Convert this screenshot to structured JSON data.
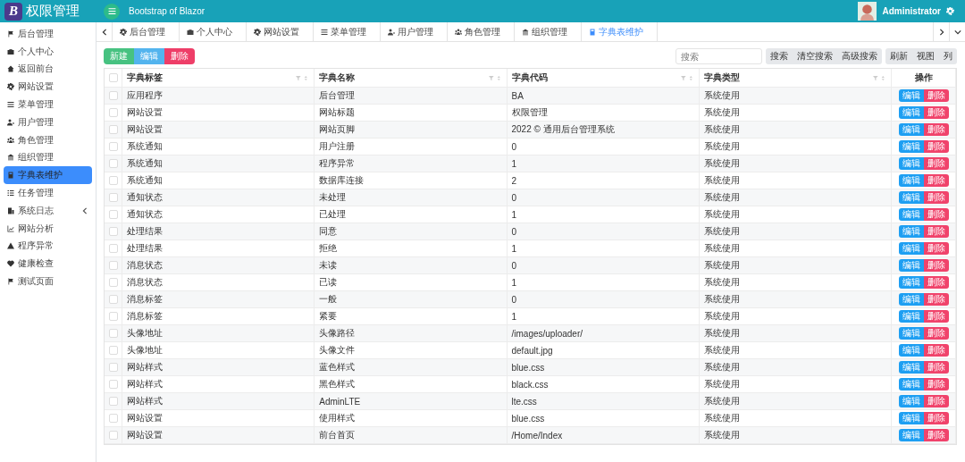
{
  "header": {
    "logo": "B",
    "title": "权限管理",
    "subtitle": "Bootstrap of Blazor",
    "user": "Administrator"
  },
  "sidebar": {
    "items": [
      {
        "label": "后台管理",
        "selected": false,
        "kind": "link"
      },
      {
        "label": "个人中心",
        "selected": false,
        "kind": "link"
      },
      {
        "label": "返回前台",
        "selected": false,
        "kind": "link"
      },
      {
        "label": "网站设置",
        "selected": false,
        "kind": "link"
      },
      {
        "label": "菜单管理",
        "selected": false,
        "kind": "link"
      },
      {
        "label": "用户管理",
        "selected": false,
        "kind": "link"
      },
      {
        "label": "角色管理",
        "selected": false,
        "kind": "link"
      },
      {
        "label": "组织管理",
        "selected": false,
        "kind": "link"
      },
      {
        "label": "字典表维护",
        "selected": true,
        "kind": "link"
      },
      {
        "label": "任务管理",
        "selected": false,
        "kind": "link"
      },
      {
        "label": "系统日志",
        "selected": false,
        "kind": "group"
      },
      {
        "label": "网站分析",
        "selected": false,
        "kind": "link"
      },
      {
        "label": "程序异常",
        "selected": false,
        "kind": "link"
      },
      {
        "label": "健康检查",
        "selected": false,
        "kind": "link"
      },
      {
        "label": "测试页面",
        "selected": false,
        "kind": "link"
      }
    ]
  },
  "tabs": [
    {
      "label": "后台管理",
      "selected": false
    },
    {
      "label": "个人中心",
      "selected": false
    },
    {
      "label": "网站设置",
      "selected": false
    },
    {
      "label": "菜单管理",
      "selected": false
    },
    {
      "label": "用户管理",
      "selected": false
    },
    {
      "label": "角色管理",
      "selected": false
    },
    {
      "label": "组织管理",
      "selected": false
    },
    {
      "label": "字典表维护",
      "selected": true
    }
  ],
  "toolbar": {
    "actions": [
      {
        "label": "新建",
        "kind": "create"
      },
      {
        "label": "编辑",
        "kind": "edit"
      },
      {
        "label": "删除",
        "kind": "delete"
      }
    ],
    "search": {
      "placeholder": "搜索"
    },
    "search_buttons": [
      "搜索",
      "清空搜索",
      "高级搜索"
    ],
    "view_buttons": [
      "刷新",
      "视图",
      "列"
    ]
  },
  "table": {
    "all_checked": false,
    "columns": [
      {
        "label": "字典标签",
        "filterable": true
      },
      {
        "label": "字典名称",
        "filterable": true
      },
      {
        "label": "字典代码",
        "filterable": true
      },
      {
        "label": "字典类型",
        "filterable": true
      },
      {
        "label": "操作",
        "filterable": false
      }
    ],
    "rows": [
      {
        "checked": false,
        "cells": [
          "应用程序",
          "后台管理",
          "BA",
          "系统使用"
        ],
        "actions": [
          {
            "label": "编辑",
            "kind": "edit"
          },
          {
            "label": "删除",
            "kind": "delete"
          }
        ]
      },
      {
        "checked": false,
        "cells": [
          "网站设置",
          "网站标题",
          "权限管理",
          "系统使用"
        ],
        "actions": [
          {
            "label": "编辑",
            "kind": "edit"
          },
          {
            "label": "删除",
            "kind": "delete"
          }
        ]
      },
      {
        "checked": false,
        "cells": [
          "网站设置",
          "网站页脚",
          "2022 © 通用后台管理系统",
          "系统使用"
        ],
        "actions": [
          {
            "label": "编辑",
            "kind": "edit"
          },
          {
            "label": "删除",
            "kind": "delete"
          }
        ]
      },
      {
        "checked": false,
        "cells": [
          "系统通知",
          "用户注册",
          "0",
          "系统使用"
        ],
        "actions": [
          {
            "label": "编辑",
            "kind": "edit"
          },
          {
            "label": "删除",
            "kind": "delete"
          }
        ]
      },
      {
        "checked": false,
        "cells": [
          "系统通知",
          "程序异常",
          "1",
          "系统使用"
        ],
        "actions": [
          {
            "label": "编辑",
            "kind": "edit"
          },
          {
            "label": "删除",
            "kind": "delete"
          }
        ]
      },
      {
        "checked": false,
        "cells": [
          "系统通知",
          "数据库连接",
          "2",
          "系统使用"
        ],
        "actions": [
          {
            "label": "编辑",
            "kind": "edit"
          },
          {
            "label": "删除",
            "kind": "delete"
          }
        ]
      },
      {
        "checked": false,
        "cells": [
          "通知状态",
          "未处理",
          "0",
          "系统使用"
        ],
        "actions": [
          {
            "label": "编辑",
            "kind": "edit"
          },
          {
            "label": "删除",
            "kind": "delete"
          }
        ]
      },
      {
        "checked": false,
        "cells": [
          "通知状态",
          "已处理",
          "1",
          "系统使用"
        ],
        "actions": [
          {
            "label": "编辑",
            "kind": "edit"
          },
          {
            "label": "删除",
            "kind": "delete"
          }
        ]
      },
      {
        "checked": false,
        "cells": [
          "处理结果",
          "同意",
          "0",
          "系统使用"
        ],
        "actions": [
          {
            "label": "编辑",
            "kind": "edit"
          },
          {
            "label": "删除",
            "kind": "delete"
          }
        ]
      },
      {
        "checked": false,
        "cells": [
          "处理结果",
          "拒绝",
          "1",
          "系统使用"
        ],
        "actions": [
          {
            "label": "编辑",
            "kind": "edit"
          },
          {
            "label": "删除",
            "kind": "delete"
          }
        ]
      },
      {
        "checked": false,
        "cells": [
          "消息状态",
          "未读",
          "0",
          "系统使用"
        ],
        "actions": [
          {
            "label": "编辑",
            "kind": "edit"
          },
          {
            "label": "删除",
            "kind": "delete"
          }
        ]
      },
      {
        "checked": false,
        "cells": [
          "消息状态",
          "已读",
          "1",
          "系统使用"
        ],
        "actions": [
          {
            "label": "编辑",
            "kind": "edit"
          },
          {
            "label": "删除",
            "kind": "delete"
          }
        ]
      },
      {
        "checked": false,
        "cells": [
          "消息标签",
          "一般",
          "0",
          "系统使用"
        ],
        "actions": [
          {
            "label": "编辑",
            "kind": "edit"
          },
          {
            "label": "删除",
            "kind": "delete"
          }
        ]
      },
      {
        "checked": false,
        "cells": [
          "消息标签",
          "紧要",
          "1",
          "系统使用"
        ],
        "actions": [
          {
            "label": "编辑",
            "kind": "edit"
          },
          {
            "label": "删除",
            "kind": "delete"
          }
        ]
      },
      {
        "checked": false,
        "cells": [
          "头像地址",
          "头像路径",
          "/images/uploader/",
          "系统使用"
        ],
        "actions": [
          {
            "label": "编辑",
            "kind": "edit"
          },
          {
            "label": "删除",
            "kind": "delete"
          }
        ]
      },
      {
        "checked": false,
        "cells": [
          "头像地址",
          "头像文件",
          "default.jpg",
          "系统使用"
        ],
        "actions": [
          {
            "label": "编辑",
            "kind": "edit"
          },
          {
            "label": "删除",
            "kind": "delete"
          }
        ]
      },
      {
        "checked": false,
        "cells": [
          "网站样式",
          "蓝色样式",
          "blue.css",
          "系统使用"
        ],
        "actions": [
          {
            "label": "编辑",
            "kind": "edit"
          },
          {
            "label": "删除",
            "kind": "delete"
          }
        ]
      },
      {
        "checked": false,
        "cells": [
          "网站样式",
          "黑色样式",
          "black.css",
          "系统使用"
        ],
        "actions": [
          {
            "label": "编辑",
            "kind": "edit"
          },
          {
            "label": "删除",
            "kind": "delete"
          }
        ]
      },
      {
        "checked": false,
        "cells": [
          "网站样式",
          "AdminLTE",
          "lte.css",
          "系统使用"
        ],
        "actions": [
          {
            "label": "编辑",
            "kind": "edit"
          },
          {
            "label": "删除",
            "kind": "delete"
          }
        ]
      },
      {
        "checked": false,
        "cells": [
          "网站设置",
          "使用样式",
          "blue.css",
          "系统使用"
        ],
        "actions": [
          {
            "label": "编辑",
            "kind": "edit"
          },
          {
            "label": "删除",
            "kind": "delete"
          }
        ]
      },
      {
        "checked": false,
        "cells": [
          "网站设置",
          "前台首页",
          "/Home/Index",
          "系统使用"
        ],
        "actions": [
          {
            "label": "编辑",
            "kind": "edit"
          },
          {
            "label": "删除",
            "kind": "delete"
          }
        ]
      }
    ]
  }
}
